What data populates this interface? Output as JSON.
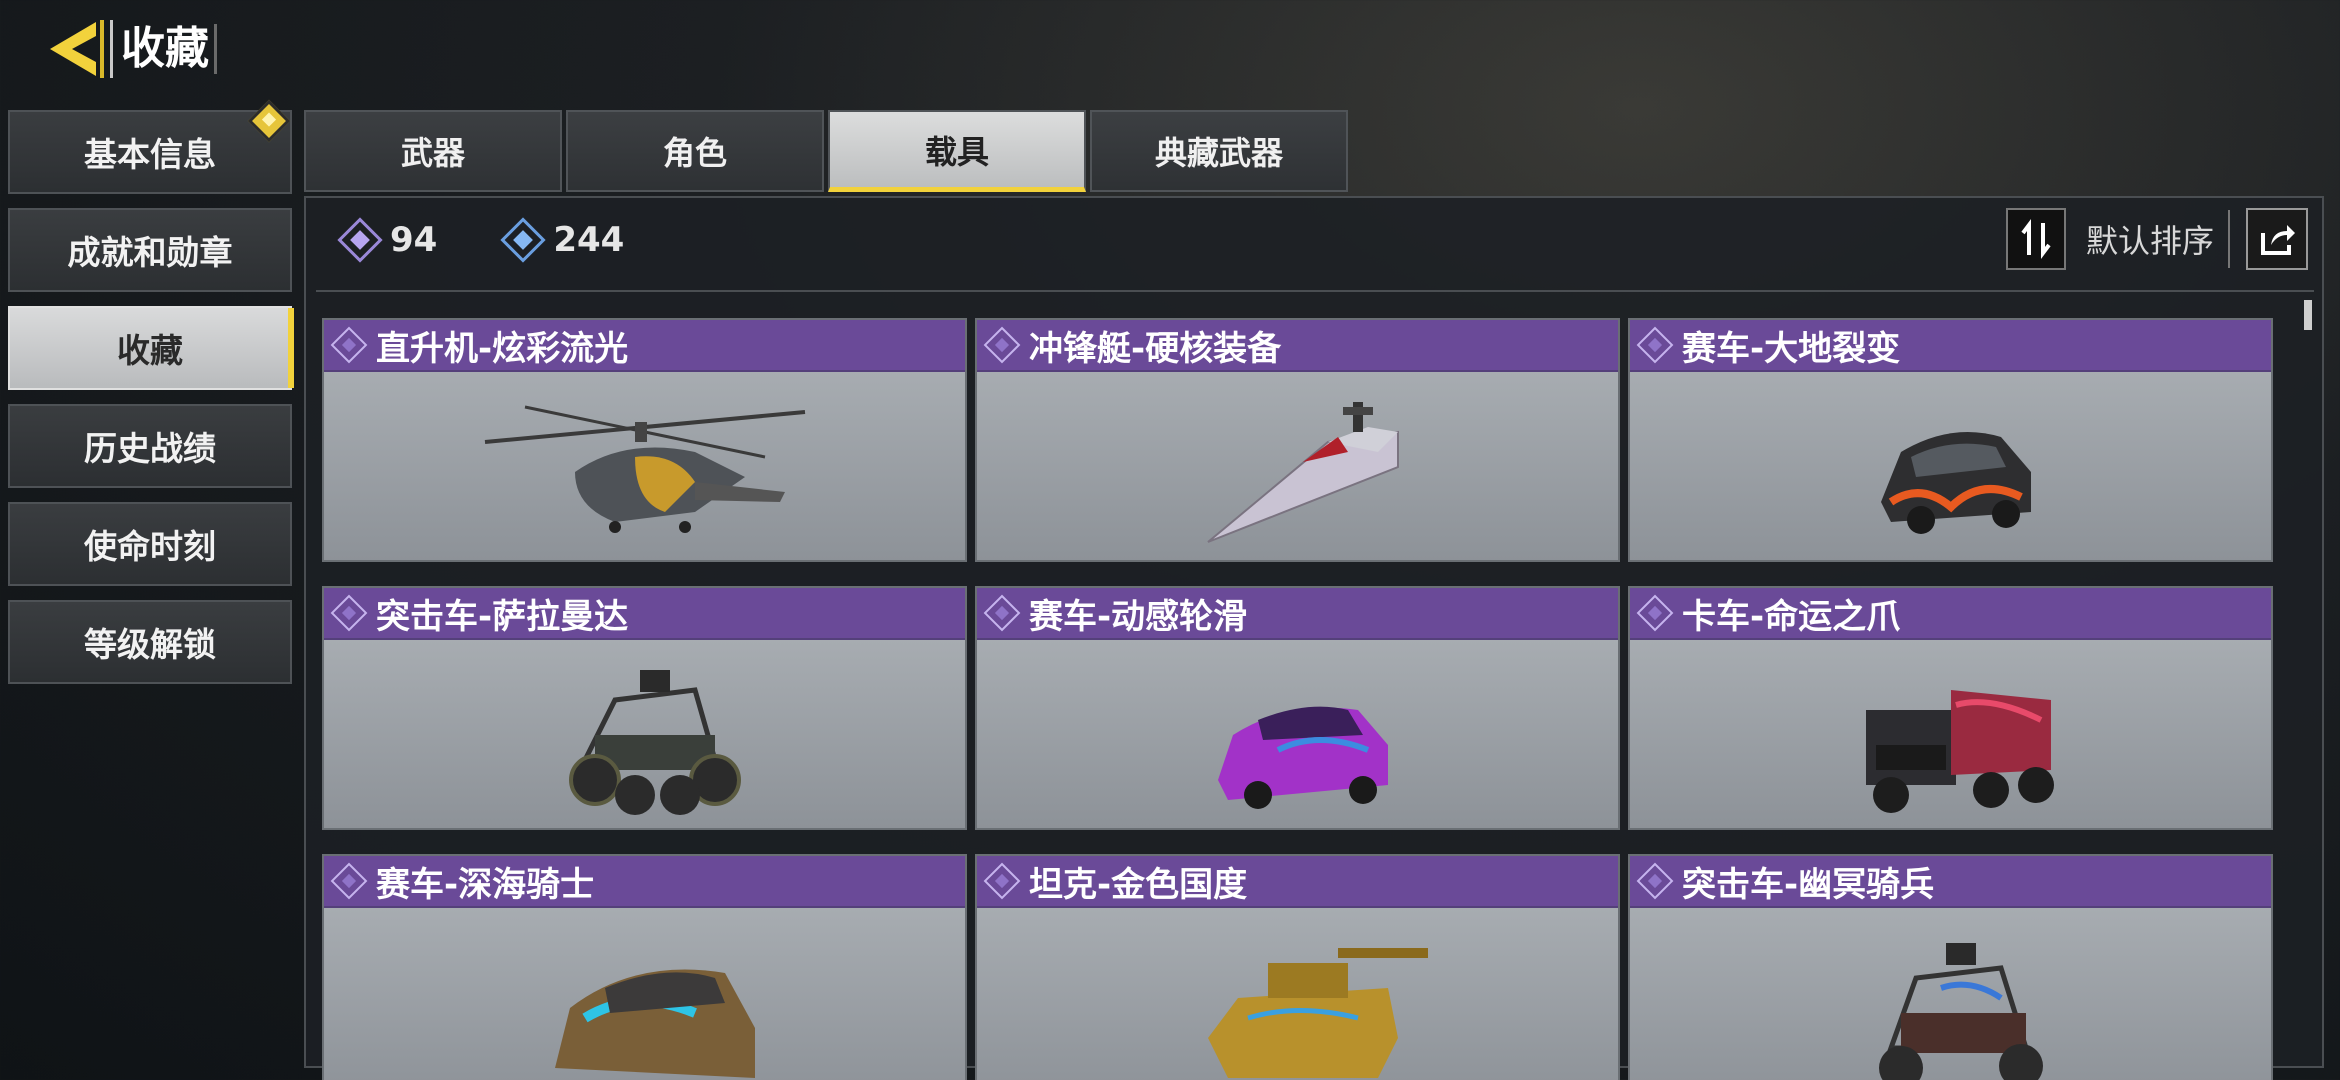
{
  "header": {
    "title": "收藏"
  },
  "sidebar": {
    "items": [
      {
        "label": "基本信息"
      },
      {
        "label": "成就和勋章"
      },
      {
        "label": "收藏"
      },
      {
        "label": "历史战绩"
      },
      {
        "label": "使命时刻"
      },
      {
        "label": "等级解锁"
      }
    ],
    "active_index": 2
  },
  "tabs": [
    {
      "label": "武器"
    },
    {
      "label": "角色"
    },
    {
      "label": "载具"
    },
    {
      "label": "典藏武器"
    }
  ],
  "currency": {
    "purple": "94",
    "blue": "244"
  },
  "sort": {
    "label": "默认排序"
  },
  "items": [
    {
      "name": "直升机-炫彩流光",
      "icon": "helicopter"
    },
    {
      "name": "冲锋艇-硬核装备",
      "icon": "boat"
    },
    {
      "name": "赛车-大地裂变",
      "icon": "race-car"
    },
    {
      "name": "突击车-萨拉曼达",
      "icon": "buggy"
    },
    {
      "name": "赛车-动感轮滑",
      "icon": "race-car"
    },
    {
      "name": "卡车-命运之爪",
      "icon": "truck"
    },
    {
      "name": "赛车-深海骑士",
      "icon": "race-car"
    },
    {
      "name": "坦克-金色国度",
      "icon": "tank"
    },
    {
      "name": "突击车-幽冥骑兵",
      "icon": "buggy"
    }
  ],
  "colors": {
    "accent": "#f2d23c",
    "card_header": "#6a4a98"
  }
}
